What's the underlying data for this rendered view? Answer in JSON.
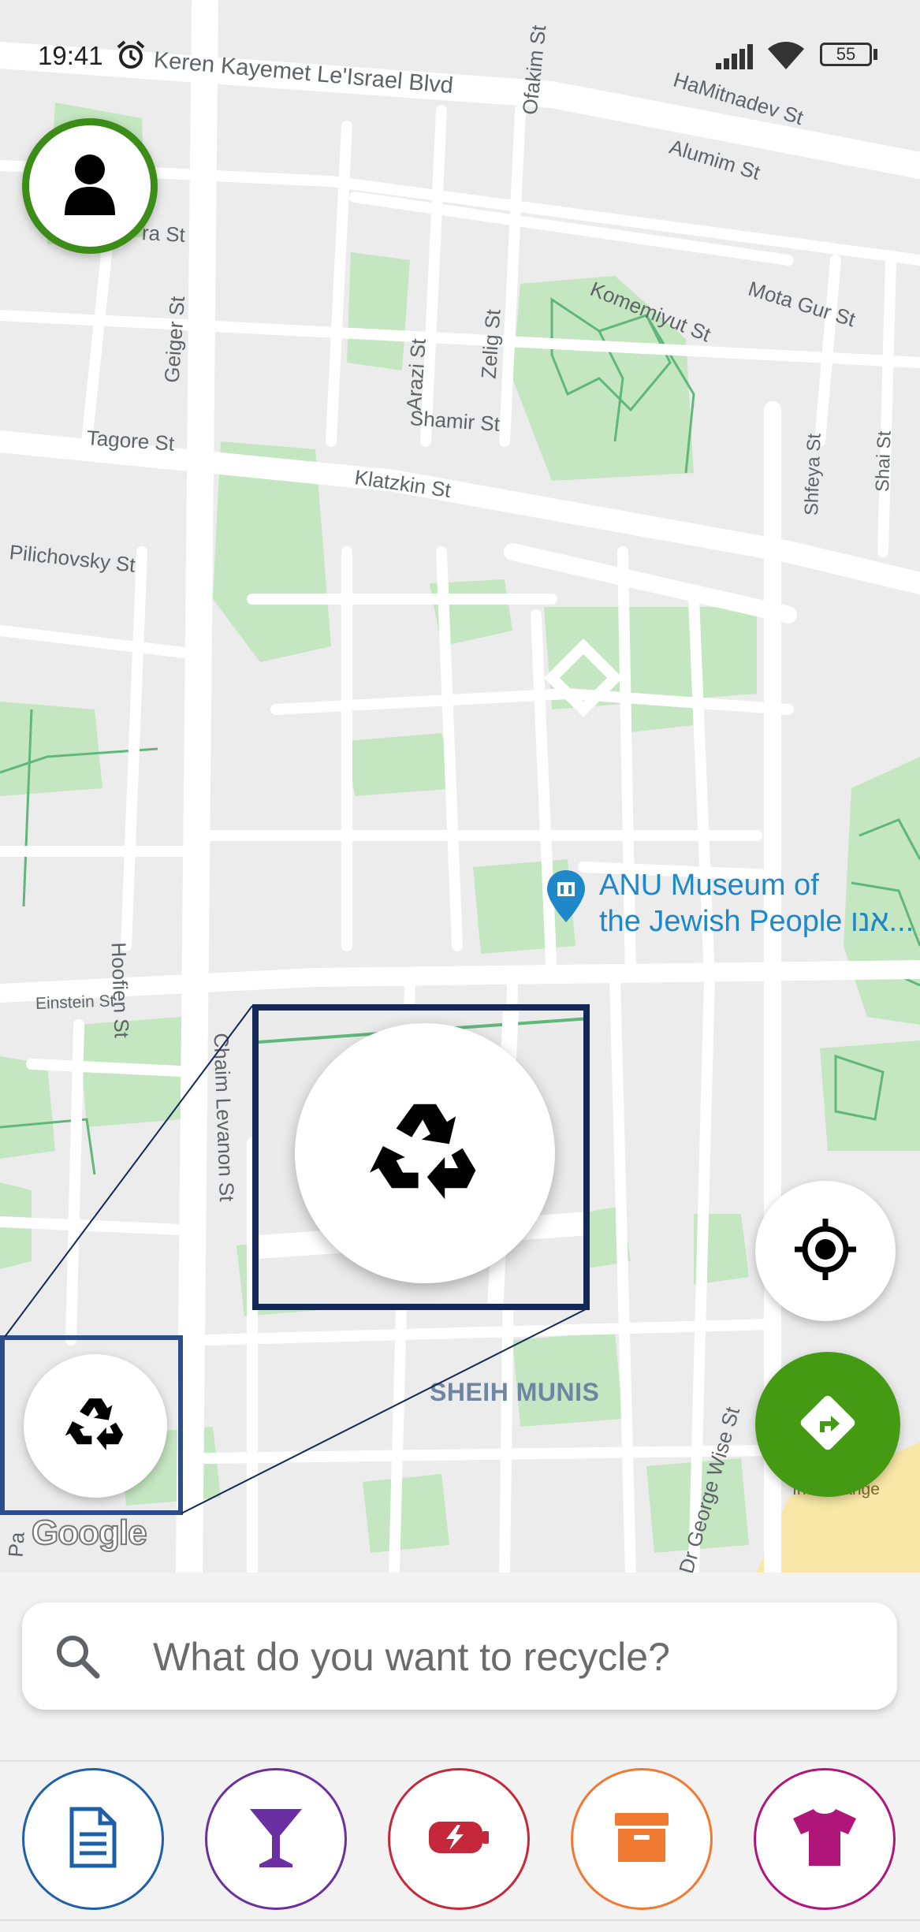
{
  "status_bar": {
    "time": "19:41",
    "battery": "55",
    "icons": [
      "alarm-icon",
      "signal-icon",
      "wifi-icon",
      "battery-icon"
    ]
  },
  "map": {
    "streets": [
      "Keren Kayemet Le'Israel Blvd",
      "Ofakim St",
      "HaMitnadev St",
      "Alumim St",
      "ra St",
      "Geiger St",
      "Komemiyut St",
      "Mota Gur St",
      "Zelig St",
      "Arazi St",
      "Shamir St",
      "Tagore St",
      "Klatzkin St",
      "Shfeya St",
      "Shai St",
      "Pilichovsky St",
      "Hoofien St",
      "Einstein St",
      "Chaim Levanon St",
      "Dr George Wise St",
      "Pa"
    ],
    "poi": {
      "line1": "ANU Museum of",
      "line2": "the Jewish People אנו..."
    },
    "district": "SHEIH MUNIS",
    "interchange_label": "Interchange",
    "attribution": "Google"
  },
  "buttons": {
    "profile_icon": "user-icon",
    "locate_icon": "crosshair-icon",
    "directions_icon": "directions-icon",
    "recycle_icon": "recycle-icon"
  },
  "colors": {
    "primary_green": "#459a14",
    "profile_ring": "#3c8d18",
    "highlight_box": "#142858",
    "paper": "#1e5fa8",
    "glass": "#6a2fa0",
    "battery": "#c6283b",
    "carton": "#f07a32",
    "textile": "#b0157a"
  },
  "search": {
    "placeholder": "What do you want to recycle?"
  },
  "categories": [
    {
      "name": "paper",
      "icon": "document-icon"
    },
    {
      "name": "glass",
      "icon": "cocktail-glass-icon"
    },
    {
      "name": "batteries",
      "icon": "battery-icon"
    },
    {
      "name": "cardboard",
      "icon": "box-icon"
    },
    {
      "name": "textile",
      "icon": "tshirt-icon"
    }
  ]
}
